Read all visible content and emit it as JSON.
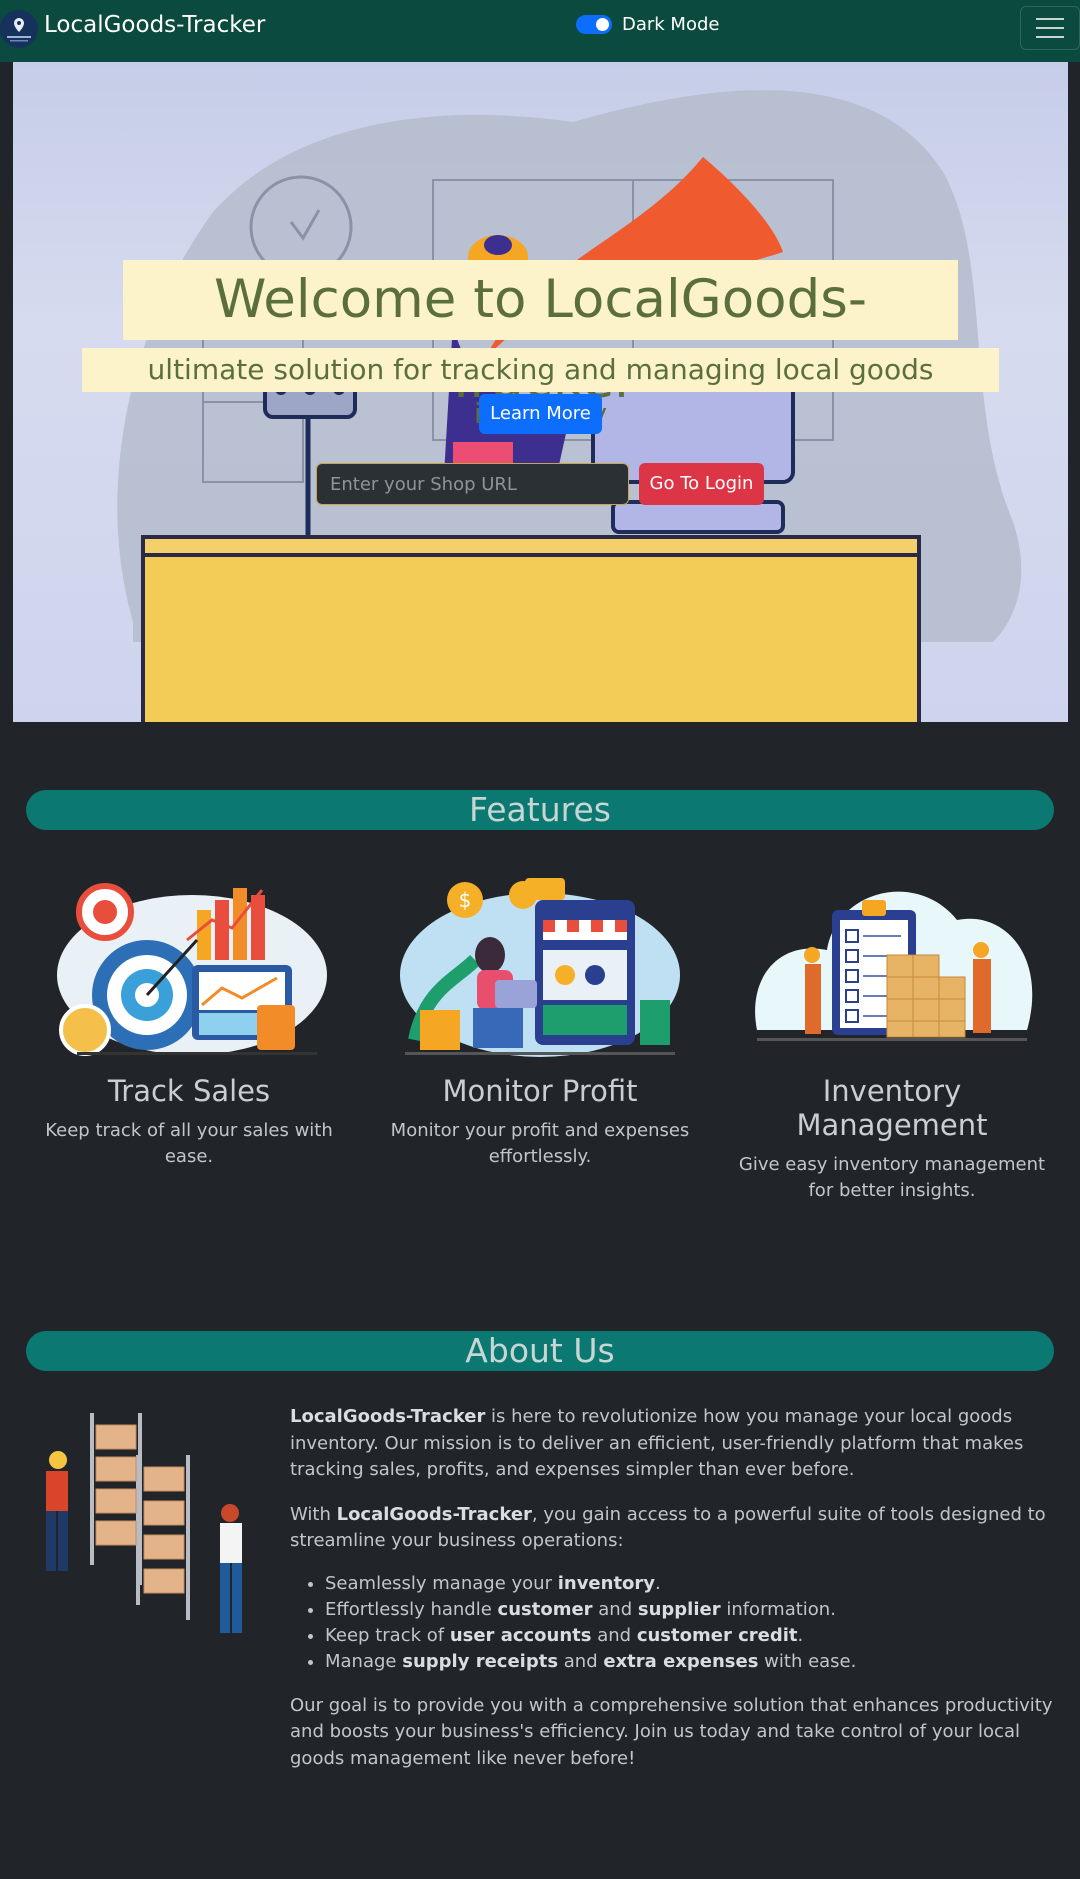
{
  "nav": {
    "brand": "LocalGoods-Tracker",
    "dark_mode_label": "Dark Mode"
  },
  "hero": {
    "title": "Welcome to LocalGoods-Tracker",
    "subtitle": "ultimate solution for tracking and managing local goods inventory",
    "learn_more": "Learn More",
    "shop_url_placeholder": "Enter your Shop URL",
    "login_button": "Go To Login"
  },
  "features": {
    "heading": "Features",
    "items": [
      {
        "title": "Track Sales",
        "desc": "Keep track of all your sales with ease.",
        "icon": "sales-target-illustration"
      },
      {
        "title": "Monitor Profit",
        "desc": "Monitor your profit and expenses effortlessly.",
        "icon": "profit-shop-illustration"
      },
      {
        "title": "Inventory Management",
        "desc": "Give easy inventory management for better insights.",
        "icon": "inventory-checklist-illustration"
      }
    ]
  },
  "about": {
    "heading": "About Us",
    "p1_brand": "LocalGoods-Tracker",
    "p1_rest": " is here to revolutionize how you manage your local goods inventory. Our mission is to deliver an efficient, user-friendly platform that makes tracking sales, profits, and expenses simpler than ever before.",
    "p2_pre": "With ",
    "p2_brand": "LocalGoods-Tracker",
    "p2_rest": ", you gain access to a powerful suite of tools designed to streamline your business operations:",
    "list": {
      "i1_pre": "Seamlessly manage your ",
      "i1_b1": "inventory",
      "i1_post": ".",
      "i2_pre": "Effortlessly handle ",
      "i2_b1": "customer",
      "i2_mid": " and ",
      "i2_b2": "supplier",
      "i2_post": " information.",
      "i3_pre": "Keep track of ",
      "i3_b1": "user accounts",
      "i3_mid": " and ",
      "i3_b2": "customer credit",
      "i3_post": ".",
      "i4_pre": "Manage ",
      "i4_b1": "supply receipts",
      "i4_mid": " and ",
      "i4_b2": "extra expenses",
      "i4_post": " with ease."
    },
    "p3": "Our goal is to provide you with a comprehensive solution that enhances productivity and boosts your business's efficiency. Join us today and take control of your local goods management like never before!"
  },
  "colors": {
    "navbar": "#0b4a3e",
    "background": "#212529",
    "section_pill": "#0b7872",
    "primary": "#0d6efd",
    "danger": "#dc3545",
    "hero_text": "#5b6f3c",
    "hero_highlight": "#fdf3cb"
  }
}
